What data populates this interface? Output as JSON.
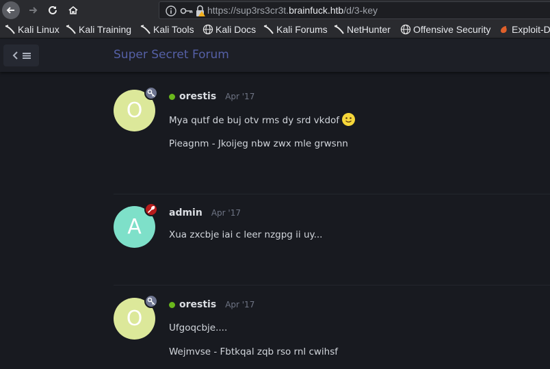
{
  "browser": {
    "url_prefix": "https://sup3rs3cr3t.",
    "url_host": "brainfuck.htb",
    "url_suffix": "/d/3-key"
  },
  "bookmarks": [
    {
      "label": "Kali Linux",
      "icon": "kali-dragon-icon"
    },
    {
      "label": "Kali Training",
      "icon": "kali-dragon-icon"
    },
    {
      "label": "Kali Tools",
      "icon": "kali-dragon-icon"
    },
    {
      "label": "Kali Docs",
      "icon": "globe-icon"
    },
    {
      "label": "Kali Forums",
      "icon": "kali-dragon-icon"
    },
    {
      "label": "NetHunter",
      "icon": "kali-dragon-icon"
    },
    {
      "label": "Offensive Security",
      "icon": "globe-icon"
    },
    {
      "label": "Exploit-D",
      "icon": "exploit-db-icon"
    }
  ],
  "forum": {
    "title": "Super Secret Forum"
  },
  "posts": [
    {
      "avatar_letter": "O",
      "avatar_color": "#dce89a",
      "badge": "key-icon",
      "badge_color": "#6e7590",
      "online": true,
      "username": "orestis",
      "time": "Apr '17",
      "lines": [
        "Mya qutf de buj otv rms dy srd vkdof",
        "Pieagnm - Jkoijeg nbw zwx mle grwsnn"
      ],
      "emoji": "smiley-emoji"
    },
    {
      "avatar_letter": "A",
      "avatar_color": "#7ee0c9",
      "badge": "wrench-icon",
      "badge_color": "#b71c1c",
      "online": false,
      "username": "admin",
      "time": "Apr '17",
      "lines": [
        "Xua zxcbje iai c leer nzgpg ii uy..."
      ]
    },
    {
      "avatar_letter": "O",
      "avatar_color": "#dce89a",
      "badge": "key-icon",
      "badge_color": "#6e7590",
      "online": true,
      "username": "orestis",
      "time": "Apr '17",
      "lines": [
        "Ufgoqcbje....",
        "Wejmvse - Fbtkqal zqb rso rnl cwihsf"
      ]
    }
  ]
}
